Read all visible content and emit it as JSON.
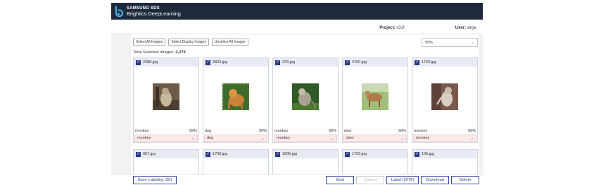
{
  "header": {
    "brand_line1": "SAMSUNG SDS",
    "brand_line2": "Brightics DeepLearning",
    "logo_icon": "brightics-logo-icon"
  },
  "projectbar": {
    "project_label": "Project:",
    "project_value": "v3.8",
    "user_label": "User:",
    "user_value": "sinja"
  },
  "toolbar": {
    "select_all": "Select All Images",
    "select_display": "Select Display Images",
    "unselect_all": "Unselect All Images",
    "zoom_value": "95%",
    "total_label": "Total Selected Images:",
    "total_value": "2,276"
  },
  "cards_row1": [
    {
      "file": "2388.jpg",
      "pred": "monkey",
      "conf": "99%",
      "label": "monkey",
      "checked": true
    },
    {
      "file": "2823.jpg",
      "pred": "dog",
      "conf": "99%",
      "label": "dog",
      "checked": true
    },
    {
      "file": "379.jpg",
      "pred": "monkey",
      "conf": "99%",
      "label": "monkey",
      "checked": true
    },
    {
      "file": "4700.jpg",
      "pred": "deer",
      "conf": "99%",
      "label": "deer",
      "checked": true
    },
    {
      "file": "1763.jpg",
      "pred": "monkey",
      "conf": "99%",
      "label": "monkey",
      "checked": true
    }
  ],
  "cards_row2": [
    {
      "file": "957.jpg",
      "checked": true
    },
    {
      "file": "1790.jpg",
      "checked": true
    },
    {
      "file": "1806.jpg",
      "checked": true
    },
    {
      "file": "1793.jpg",
      "checked": true
    },
    {
      "file": "105.jpg",
      "checked": true
    }
  ],
  "bottom": {
    "save_labeling": "Save Labeling (30)",
    "start": "Start",
    "cancel": "Cancel",
    "label": "Label (2276)",
    "download": "Download",
    "delete": "Delete"
  },
  "colors": {
    "topbar": "#1e2a3c",
    "accent": "#2a3a86",
    "label_bg": "#fde9ea"
  }
}
